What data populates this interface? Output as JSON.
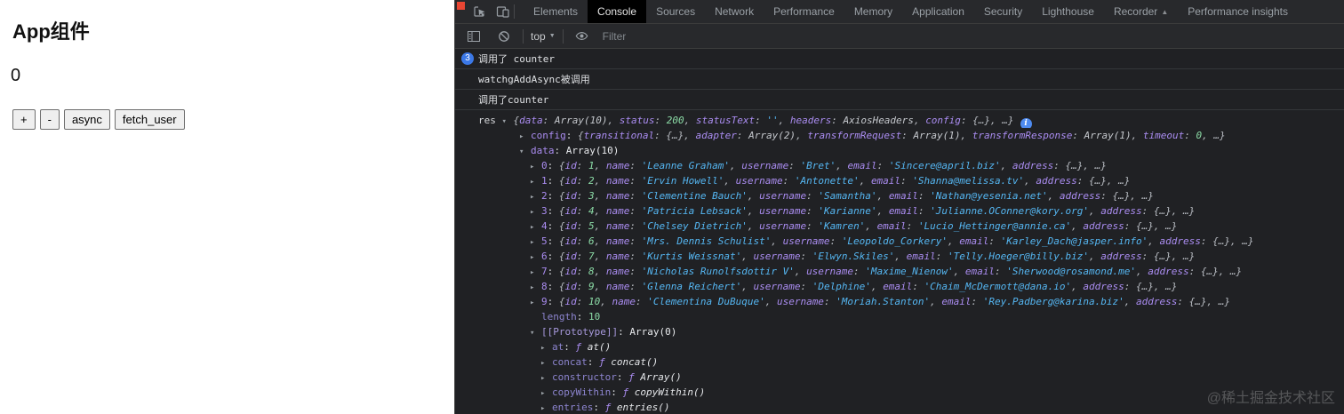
{
  "app": {
    "title": "App组件",
    "counter_value": "0",
    "buttons": [
      {
        "name": "increment",
        "label": "+"
      },
      {
        "name": "decrement",
        "label": "-"
      },
      {
        "name": "async",
        "label": "async"
      },
      {
        "name": "fetch-user",
        "label": "fetch_user"
      }
    ]
  },
  "devtools": {
    "tabs": [
      {
        "name": "elements",
        "label": "Elements"
      },
      {
        "name": "console",
        "label": "Console",
        "active": true
      },
      {
        "name": "sources",
        "label": "Sources"
      },
      {
        "name": "network",
        "label": "Network"
      },
      {
        "name": "performance",
        "label": "Performance"
      },
      {
        "name": "memory",
        "label": "Memory"
      },
      {
        "name": "application",
        "label": "Application"
      },
      {
        "name": "security",
        "label": "Security"
      },
      {
        "name": "lighthouse",
        "label": "Lighthouse"
      },
      {
        "name": "recorder",
        "label": "Recorder",
        "badge": "▲"
      },
      {
        "name": "performance-insights",
        "label": "Performance insights"
      }
    ],
    "toolbar": {
      "context_label": "top",
      "filter_placeholder": "Filter"
    },
    "console": {
      "messages": [
        {
          "badge": "3",
          "text": "调用了 counter"
        },
        {
          "text": "watchgAddAsync被调用"
        },
        {
          "text": "调用了counter"
        }
      ],
      "tree": [
        {
          "type": "raw",
          "depth": 0,
          "arrow": "d",
          "lead": "res ",
          "info": true,
          "tokens": [
            [
              "pi",
              "{"
            ],
            [
              "ki",
              "data"
            ],
            [
              "pi",
              ": "
            ],
            [
              "clsi",
              "Array(10)"
            ],
            [
              "pi",
              ", "
            ],
            [
              "ki",
              "status"
            ],
            [
              "pi",
              ": "
            ],
            [
              "ni",
              "200"
            ],
            [
              "pi",
              ", "
            ],
            [
              "ki",
              "statusText"
            ],
            [
              "pi",
              ": "
            ],
            [
              "s",
              "''"
            ],
            [
              "pi",
              ", "
            ],
            [
              "ki",
              "headers"
            ],
            [
              "pi",
              ": "
            ],
            [
              "clsi",
              "AxiosHeaders"
            ],
            [
              "pi",
              ", "
            ],
            [
              "ki",
              "config"
            ],
            [
              "pi",
              ": {…}, …}"
            ]
          ]
        },
        {
          "type": "raw",
          "depth": 1,
          "arrow": "r",
          "tokens": [
            [
              "k",
              "config"
            ],
            [
              "p",
              ": "
            ],
            [
              "pi",
              "{"
            ],
            [
              "ki",
              "transitional"
            ],
            [
              "pi",
              ": {…}, "
            ],
            [
              "ki",
              "adapter"
            ],
            [
              "pi",
              ": "
            ],
            [
              "clsi",
              "Array(2)"
            ],
            [
              "pi",
              ", "
            ],
            [
              "ki",
              "transformRequest"
            ],
            [
              "pi",
              ": "
            ],
            [
              "clsi",
              "Array(1)"
            ],
            [
              "pi",
              ", "
            ],
            [
              "ki",
              "transformResponse"
            ],
            [
              "pi",
              ": "
            ],
            [
              "clsi",
              "Array(1)"
            ],
            [
              "pi",
              ", "
            ],
            [
              "ki",
              "timeout"
            ],
            [
              "pi",
              ": "
            ],
            [
              "ni",
              "0"
            ],
            [
              "pi",
              ", …}"
            ]
          ]
        },
        {
          "type": "raw",
          "depth": 1,
          "arrow": "d",
          "tokens": [
            [
              "k",
              "data"
            ],
            [
              "p",
              ": "
            ],
            [
              "cls",
              "Array(10)"
            ]
          ]
        },
        {
          "type": "user",
          "depth": 2,
          "arrow": "r",
          "index": 0,
          "id": "1",
          "name": "Leanne Graham",
          "username": "Bret",
          "email": "Sincere@april.biz"
        },
        {
          "type": "user",
          "depth": 2,
          "arrow": "r",
          "index": 1,
          "id": "2",
          "name": "Ervin Howell",
          "username": "Antonette",
          "email": "Shanna@melissa.tv"
        },
        {
          "type": "user",
          "depth": 2,
          "arrow": "r",
          "index": 2,
          "id": "3",
          "name": "Clementine Bauch",
          "username": "Samantha",
          "email": "Nathan@yesenia.net"
        },
        {
          "type": "user",
          "depth": 2,
          "arrow": "r",
          "index": 3,
          "id": "4",
          "name": "Patricia Lebsack",
          "username": "Karianne",
          "email": "Julianne.OConner@kory.org"
        },
        {
          "type": "user",
          "depth": 2,
          "arrow": "r",
          "index": 4,
          "id": "5",
          "name": "Chelsey Dietrich",
          "username": "Kamren",
          "email": "Lucio_Hettinger@annie.ca"
        },
        {
          "type": "user",
          "depth": 2,
          "arrow": "r",
          "index": 5,
          "id": "6",
          "name": "Mrs. Dennis Schulist",
          "username": "Leopoldo_Corkery",
          "email": "Karley_Dach@jasper.info"
        },
        {
          "type": "user",
          "depth": 2,
          "arrow": "r",
          "index": 6,
          "id": "7",
          "name": "Kurtis Weissnat",
          "username": "Elwyn.Skiles",
          "email": "Telly.Hoeger@billy.biz"
        },
        {
          "type": "user",
          "depth": 2,
          "arrow": "r",
          "index": 7,
          "id": "8",
          "name": "Nicholas Runolfsdottir V",
          "username": "Maxime_Nienow",
          "email": "Sherwood@rosamond.me"
        },
        {
          "type": "user",
          "depth": 2,
          "arrow": "r",
          "index": 8,
          "id": "9",
          "name": "Glenna Reichert",
          "username": "Delphine",
          "email": "Chaim_McDermott@dana.io"
        },
        {
          "type": "user",
          "depth": 2,
          "arrow": "r",
          "index": 9,
          "id": "10",
          "name": "Clementina DuBuque",
          "username": "Moriah.Stanton",
          "email": "Rey.Padberg@karina.biz"
        },
        {
          "type": "raw",
          "depth": 2,
          "arrow": "",
          "tokens": [
            [
              "dimk",
              "length"
            ],
            [
              "p",
              ": "
            ],
            [
              "n",
              "10"
            ]
          ]
        },
        {
          "type": "raw",
          "depth": 2,
          "arrow": "d",
          "tokens": [
            [
              "proto",
              "[[Prototype]]"
            ],
            [
              "p",
              ": "
            ],
            [
              "cls",
              "Array(0)"
            ]
          ]
        },
        {
          "type": "fn",
          "depth": 3,
          "arrow": "r",
          "key": "at",
          "fn": "at()"
        },
        {
          "type": "fn",
          "depth": 3,
          "arrow": "r",
          "key": "concat",
          "fn": "concat()"
        },
        {
          "type": "fn",
          "depth": 3,
          "arrow": "r",
          "key": "constructor",
          "fn": "Array()"
        },
        {
          "type": "fn",
          "depth": 3,
          "arrow": "r",
          "key": "copyWithin",
          "fn": "copyWithin()"
        },
        {
          "type": "fn",
          "depth": 3,
          "arrow": "r",
          "key": "entries",
          "fn": "entries()"
        }
      ]
    },
    "watermark": "@稀土掘金技术社区"
  }
}
